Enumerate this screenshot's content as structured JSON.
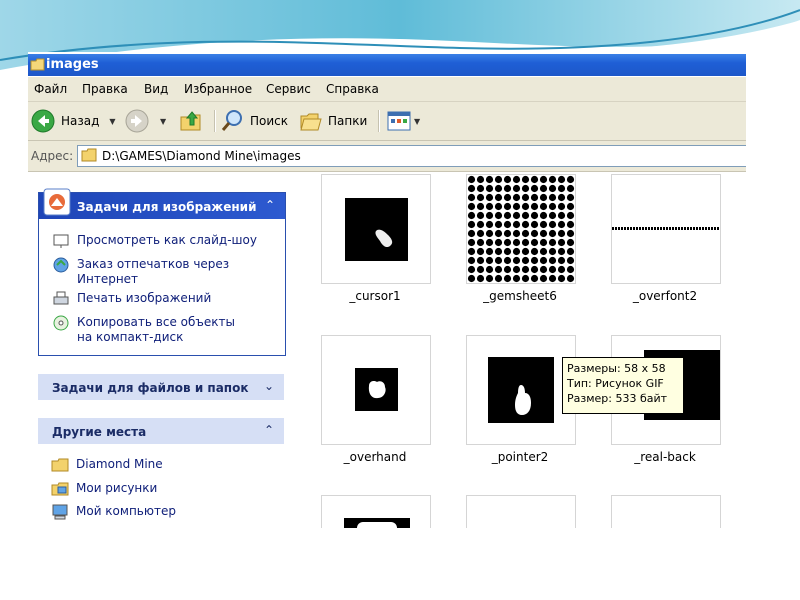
{
  "window": {
    "title": "images"
  },
  "menu": [
    "Файл",
    "Правка",
    "Вид",
    "Избранное",
    "Сервис",
    "Справка"
  ],
  "toolbar": {
    "back_label": "Назад",
    "search_label": "Поиск",
    "folders_label": "Папки"
  },
  "address": {
    "label": "Адрес:",
    "path": "D:\\GAMES\\Diamond Mine\\images"
  },
  "left_panel": {
    "image_tasks": {
      "title": "Задачи для изображений",
      "items": [
        {
          "label": "Просмотреть как слайд-шоу",
          "icon": "slideshow-icon"
        },
        {
          "label": "Заказ отпечатков через Интернет",
          "icon": "order-prints-icon"
        },
        {
          "label": "Печать изображений",
          "icon": "printer-icon"
        },
        {
          "label": "Копировать все объекты на компакт-диск",
          "icon": "cd-copy-icon"
        }
      ]
    },
    "file_tasks": {
      "title": "Задачи для файлов и папок"
    },
    "other_places": {
      "title": "Другие места",
      "items": [
        {
          "label": "Diamond Mine",
          "icon": "folder-icon"
        },
        {
          "label": "Мои рисунки",
          "icon": "my-pictures-icon"
        },
        {
          "label": "Мой компьютер",
          "icon": "my-computer-icon"
        }
      ]
    }
  },
  "files": [
    {
      "name": "_cursor1"
    },
    {
      "name": "_gemsheet6"
    },
    {
      "name": "_overfont2"
    },
    {
      "name": "_overhand"
    },
    {
      "name": "_pointer2"
    },
    {
      "name": "_real-back"
    }
  ],
  "tooltip": {
    "line1": "Размеры: 58 x 58",
    "line2": "Тип: Рисунок GIF",
    "line3": "Размер: 533 байт"
  },
  "colors": {
    "titlebar": "#1f5fd6",
    "chrome": "#ece9d8",
    "panel_head": "#1e45b7",
    "tooltip_bg": "#ffffe1"
  }
}
